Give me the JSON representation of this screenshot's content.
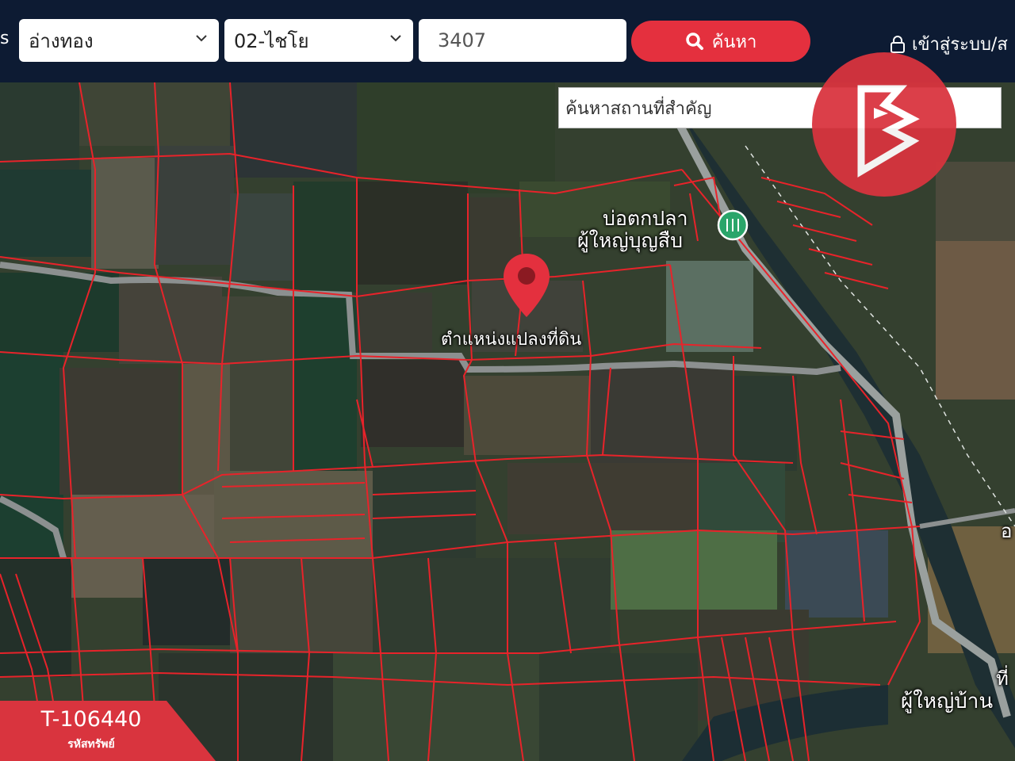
{
  "header": {
    "cut_label": "s",
    "province_select": "อ่างทอง",
    "district_select": "02-ไชโย",
    "parcel_input": "3407",
    "search_button": "ค้นหา",
    "login_link": "เข้าสู่ระบบ/ส"
  },
  "map": {
    "place_search_placeholder": "ค้นหาสถานที่สำคัญ",
    "poi_name_line1": "บ่อตกปลา",
    "poi_name_line2": "ผู้ใหญ่บุญสืบ",
    "pin_label": "ตำแหน่งแปลงที่ดิน",
    "village_label": "ผู้ใหญ่บ้าน",
    "edge_label_1": "อ",
    "edge_label_2": "ที่",
    "parcel_line_color": "#e8232a",
    "pin_color": "#e4303e"
  },
  "badge": {
    "asset_code": "T-106440",
    "asset_code_caption": "รหัสทรัพย์"
  },
  "icons": {
    "search": "search-icon",
    "lock": "lock-icon",
    "chevron": "chevron-down-icon",
    "pin": "map-pin-icon",
    "poi": "poi-marker-icon",
    "logo": "brand-logo"
  }
}
